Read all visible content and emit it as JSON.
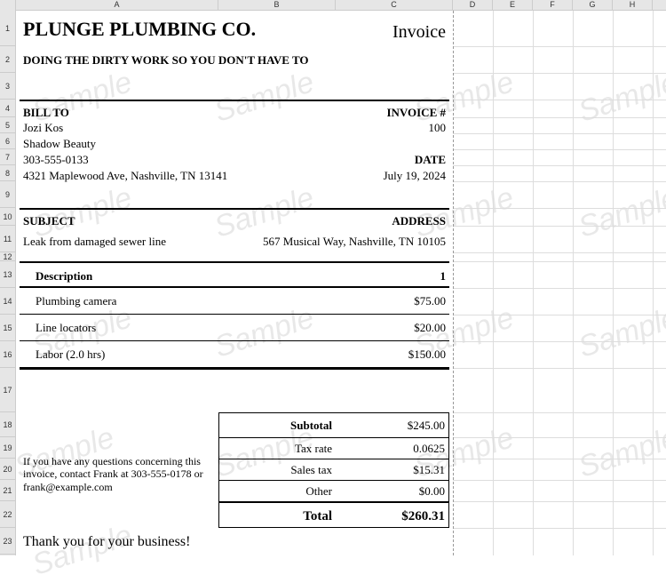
{
  "watermark": "Sample",
  "cols": [
    "A",
    "B",
    "C",
    "D",
    "E",
    "F",
    "G",
    "H"
  ],
  "rows": [
    "1",
    "2",
    "3",
    "4",
    "5",
    "6",
    "7",
    "8",
    "9",
    "10",
    "11",
    "12",
    "13",
    "14",
    "15",
    "16",
    "17",
    "18",
    "19",
    "20",
    "21",
    "22",
    "23"
  ],
  "company": {
    "name": "PLUNGE PLUMBING CO.",
    "tagline": "DOING THE DIRTY WORK SO YOU DON'T HAVE TO"
  },
  "doc_title": "Invoice",
  "labels": {
    "bill_to": "BILL TO",
    "invoice_num": "INVOICE #",
    "date": "DATE",
    "subject": "SUBJECT",
    "address": "ADDRESS"
  },
  "bill_to": {
    "name": "Jozi Kos",
    "company": "Shadow Beauty",
    "phone": "303-555-0133",
    "address": "4321 Maplewood Ave, Nashville, TN 13141"
  },
  "invoice": {
    "number": "100",
    "date": "July 19, 2024",
    "subject": "Leak from damaged sewer line",
    "service_address": "567 Musical Way, Nashville, TN 10105"
  },
  "table": {
    "col_desc": "Description",
    "col_qty": "1",
    "items": [
      {
        "desc": "Plumbing camera",
        "amount": "$75.00"
      },
      {
        "desc": "Line locators",
        "amount": "$20.00"
      },
      {
        "desc": "Labor (2.0 hrs)",
        "amount": "$150.00"
      }
    ]
  },
  "totals": {
    "subtotal_label": "Subtotal",
    "subtotal": "$245.00",
    "taxrate_label": "Tax rate",
    "taxrate": "0.0625",
    "salestax_label": "Sales tax",
    "salestax": "$15.31",
    "other_label": "Other",
    "other": "$0.00",
    "total_label": "Total",
    "total": "$260.31"
  },
  "note": "If you have any questions concerning this invoice, contact Frank at 303-555-0178 or frank@example.com",
  "thanks": "Thank you for your business!"
}
